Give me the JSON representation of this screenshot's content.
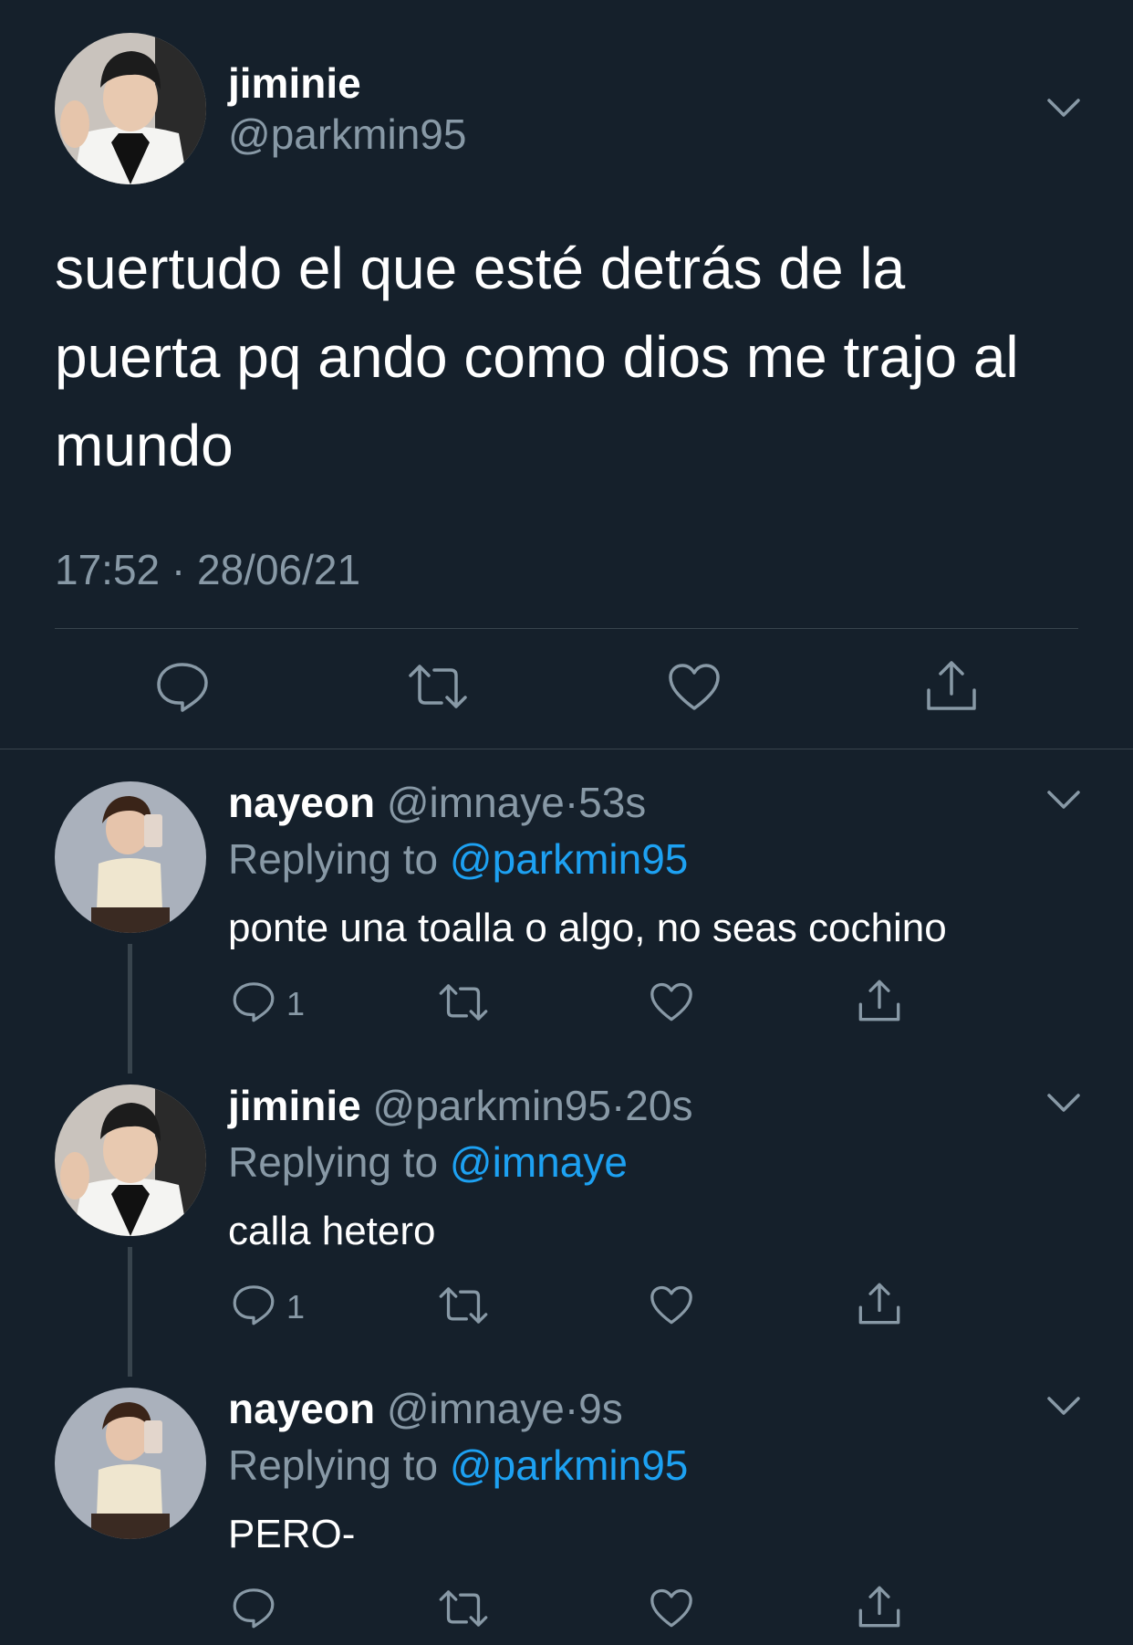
{
  "main_tweet": {
    "name": "jiminie",
    "handle": "@parkmin95",
    "text_lines": [
      "suertudo el que esté detrás de la",
      "puerta pq ando como dios me trajo al",
      "mundo"
    ],
    "timestamp": "17:52 · 28/06/21",
    "actions": [
      "reply-icon",
      "retweet-icon",
      "like-icon",
      "share-icon"
    ]
  },
  "replies": [
    {
      "name": "nayeon",
      "handle": "@imnaye",
      "separator": "·",
      "time": "53s",
      "replying_prefix": "Replying to",
      "replying_to": "@parkmin95",
      "text": "ponte una toalla o algo, no seas cochino",
      "reply_count": "1"
    },
    {
      "name": "jiminie",
      "handle": "@parkmin95",
      "separator": "·",
      "time": "20s",
      "replying_prefix": "Replying to",
      "replying_to": "@imnaye",
      "text": "calla hetero",
      "reply_count": "1"
    },
    {
      "name": "nayeon",
      "handle": "@imnaye",
      "separator": "·",
      "time": "9s",
      "replying_prefix": "Replying to",
      "replying_to": "@parkmin95",
      "text": "PERO-",
      "reply_count": ""
    }
  ],
  "colors": {
    "background": "#15202b",
    "secondary_text": "#8899a6",
    "link": "#1da1f2",
    "divider": "#38444d"
  }
}
